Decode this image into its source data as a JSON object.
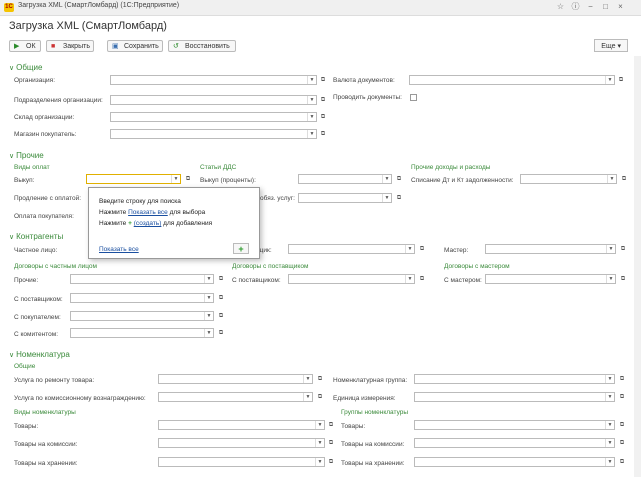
{
  "window": {
    "app_icon": "1C",
    "title": "Загрузка XML (СмартЛомбард)  (1С:Предприятие)"
  },
  "form_title": "Загрузка XML (СмартЛомбард)",
  "toolbar": {
    "ok": "ОК",
    "close": "Закрыть",
    "save": "Сохранить",
    "restore": "Восстановить",
    "more": "Еще"
  },
  "general": {
    "title": "Общие",
    "organization": "Организация:",
    "subordinate_orgs": "Подразделения организации:",
    "warehouse": "Склад организации:",
    "buyer_shop": "Магазин покупатель:",
    "doc_currency": "Валюта документов:",
    "post_documents": "Проводить документы:"
  },
  "other": {
    "title": "Прочие",
    "payment_types_header": "Виды оплат",
    "cash_flow_header": "Статьи ДДС",
    "income_expense_header": "Прочие доходы и расходы",
    "buyout": "Выкуп:",
    "extension": "Продление с оплатой:",
    "buyer_payment": "Оплата покупателя:",
    "cf_buyout": "Выкуп (проценты):",
    "cf_other": "обяз. услуг:",
    "write_off": "Списание Дт и Кт задолженности:"
  },
  "popup": {
    "line1": "Введите строку для поиска",
    "line2_pre": "Нажмите ",
    "line2_link": "Показать все",
    "line2_post": " для выбора",
    "line3_pre": "Нажмите ",
    "line3_link": "(создать)",
    "line3_post": " для добавления",
    "show_all": "Показать все"
  },
  "counterparties": {
    "title": "Контрагенты",
    "private_person": "Частное лицо:",
    "supplier": "щик:",
    "master": "Мастер:",
    "contracts_private": "Договоры с частным лицом",
    "contracts_supplier": "Договоры с поставщиком",
    "contracts_master": "Договоры с мастером",
    "other": "Прочие:",
    "with_supplier": "С поставщиком:",
    "with_buyer": "С покупателем:",
    "with_consignor": "С комитентом:",
    "c_supplier": "С поставщиком:",
    "c_master": "С мастером:"
  },
  "nomenclature": {
    "title": "Номенклатура",
    "general_header": "Общие",
    "repair_service": "Услуга по ремонту товара:",
    "commission_service": "Услуга по комиссионному вознаграждению:",
    "nomenclature_group": "Номенклатурная группа:",
    "unit": "Единица измерения:",
    "types_header": "Виды номенклатуры",
    "groups_header": "Группы номенклатуры",
    "goods": "Товары:",
    "goods_commission": "Товары на комиссии:",
    "goods_storage": "Товары на хранении:",
    "g_goods": "Товары:",
    "g_goods_commission": "Товары на комиссии:",
    "g_goods_storage": "Товары на хранении:"
  }
}
